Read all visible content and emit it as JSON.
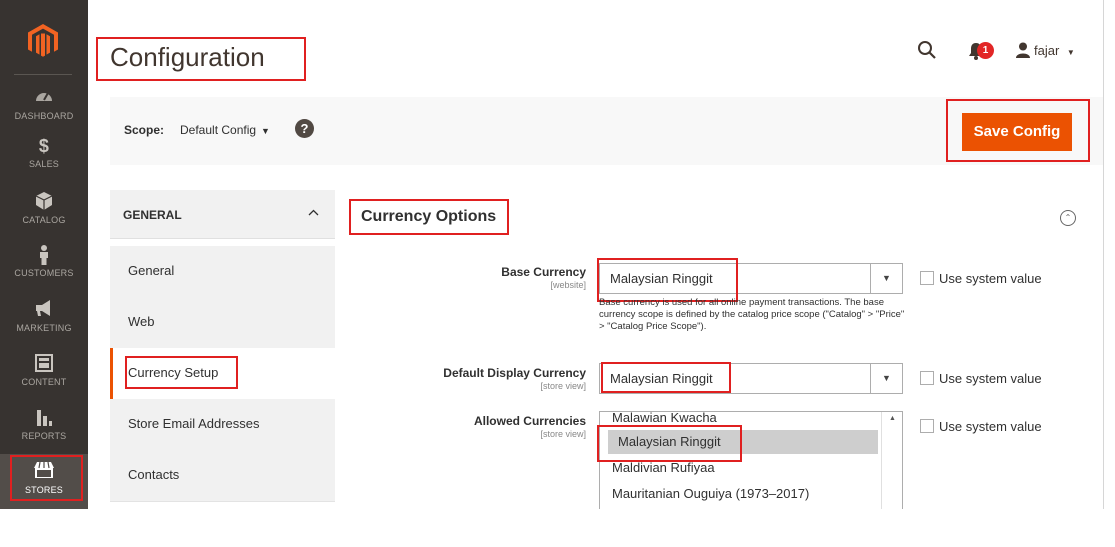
{
  "sidebar": {
    "logo": "magento-logo",
    "items": [
      {
        "label": "DASHBOARD",
        "icon": "speedometer-icon"
      },
      {
        "label": "SALES",
        "icon": "dollar-icon"
      },
      {
        "label": "CATALOG",
        "icon": "box-icon"
      },
      {
        "label": "CUSTOMERS",
        "icon": "person-icon"
      },
      {
        "label": "MARKETING",
        "icon": "megaphone-icon"
      },
      {
        "label": "CONTENT",
        "icon": "layout-icon"
      },
      {
        "label": "REPORTS",
        "icon": "bar-chart-icon"
      },
      {
        "label": "STORES",
        "icon": "store-icon",
        "active": true
      }
    ]
  },
  "header": {
    "title": "Configuration",
    "notifications_count": "1",
    "user_name": "fajar"
  },
  "scope": {
    "label": "Scope:",
    "value": "Default Config",
    "help": "?"
  },
  "actions": {
    "save_label": "Save Config"
  },
  "config_nav": {
    "group_label": "GENERAL",
    "items": [
      {
        "label": "General"
      },
      {
        "label": "Web"
      },
      {
        "label": "Currency Setup",
        "active": true
      },
      {
        "label": "Store Email Addresses"
      },
      {
        "label": "Contacts"
      }
    ]
  },
  "section": {
    "title": "Currency Options",
    "base_currency": {
      "label": "Base Currency",
      "scope": "[website]",
      "value": "Malaysian Ringgit",
      "use_system": "Use system value",
      "note": "Base currency is used for all online payment transactions. The base currency scope is defined by the catalog price scope (\"Catalog\" > \"Price\" > \"Catalog Price Scope\")."
    },
    "default_display_currency": {
      "label": "Default Display Currency",
      "scope": "[store view]",
      "value": "Malaysian Ringgit",
      "use_system": "Use system value"
    },
    "allowed_currencies": {
      "label": "Allowed Currencies",
      "scope": "[store view]",
      "options": [
        "Malawian Kwacha",
        "Malaysian Ringgit",
        "Maldivian Rufiyaa",
        "Mauritanian Ouguiya (1973–2017)"
      ],
      "selected": "Malaysian Ringgit",
      "use_system": "Use system value"
    }
  },
  "colors": {
    "sidebar_bg": "#373330",
    "accent": "#eb5202",
    "highlight": "#e02020"
  }
}
